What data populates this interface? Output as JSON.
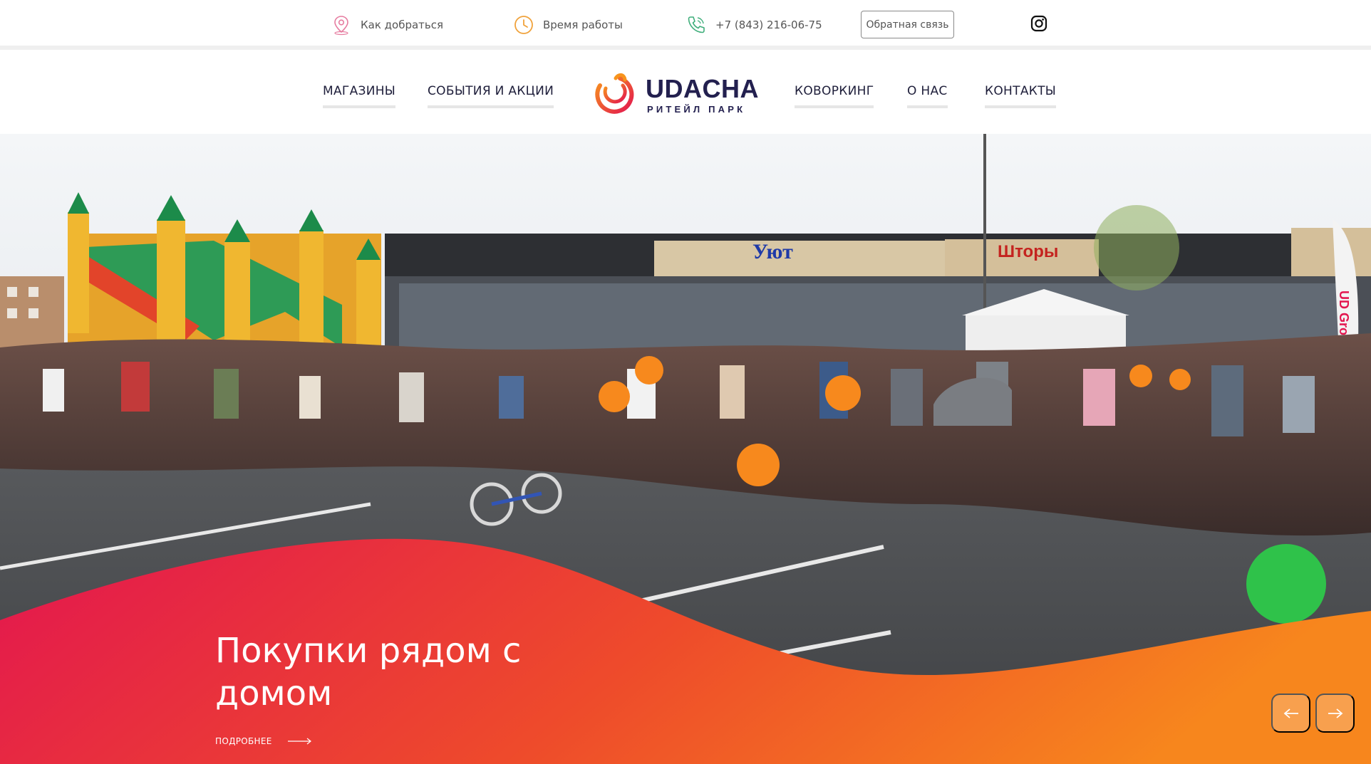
{
  "topbar": {
    "address_label": "Как добраться",
    "hours_label": "Время работы",
    "phone": "+7 (843) 216-06-75",
    "feedback_label": "Обратная связь",
    "icons": [
      "map-pin-icon",
      "clock-icon",
      "phone-icon",
      "instagram-icon"
    ]
  },
  "nav": {
    "items": [
      {
        "label": "МАГАЗИНЫ"
      },
      {
        "label": "СОБЫТИЯ И АКЦИИ"
      },
      {
        "label": "КОВОРКИНГ"
      },
      {
        "label": "О НАС"
      },
      {
        "label": "КОНТАКТЫ"
      }
    ]
  },
  "logo": {
    "name": "UDACHA",
    "subtitle": "РИТЕЙЛ ПАРК"
  },
  "hero": {
    "title": "Покупки рядом с домом",
    "more_label": "ПОДРОБНЕЕ",
    "store_signs": [
      "Уют",
      "Шторы"
    ],
    "banner_text": "UD Group"
  },
  "colors": {
    "brand_dark": "#23204f",
    "accent_orange": "#f07a22",
    "accent_red": "#e3164f",
    "address_icon": "#e67ca0",
    "hours_icon": "#f0a23b",
    "phone_icon": "#3fae7b"
  }
}
